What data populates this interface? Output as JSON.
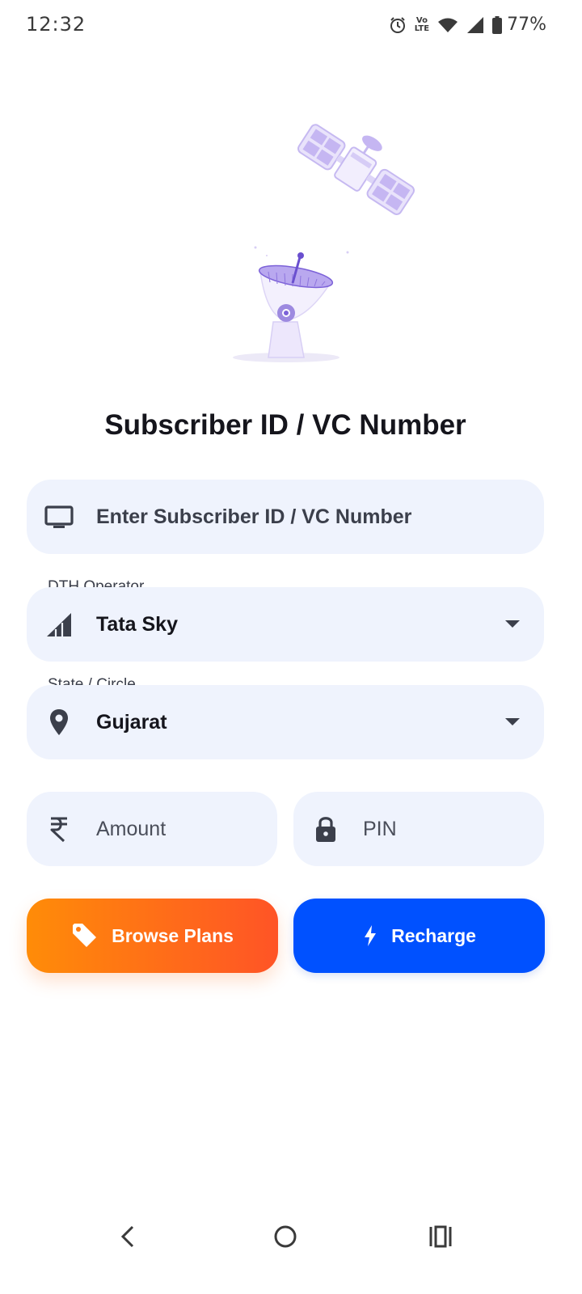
{
  "status_bar": {
    "time": "12:32",
    "battery": "77%",
    "network_label_top": "Vo",
    "network_label_bottom": "LTE"
  },
  "title": "Subscriber ID / VC Number",
  "subscriber_field": {
    "placeholder": "Enter Subscriber ID / VC Number",
    "icon": "tv-icon"
  },
  "operator_field": {
    "label": "DTH Operator",
    "value": "Tata Sky",
    "icon": "signal-icon"
  },
  "state_field": {
    "label": "State / Circle",
    "value": "Gujarat",
    "icon": "location-pin-icon"
  },
  "amount_field": {
    "placeholder": "Amount",
    "icon": "rupee-icon"
  },
  "pin_field": {
    "placeholder": "PIN",
    "icon": "lock-icon"
  },
  "buttons": {
    "browse_plans": "Browse Plans",
    "recharge": "Recharge"
  },
  "colors": {
    "primary": "#0051ff",
    "accent_orange": "#ff7a14",
    "field_bg": "#eff3fd",
    "illustration": "#a795e8"
  }
}
